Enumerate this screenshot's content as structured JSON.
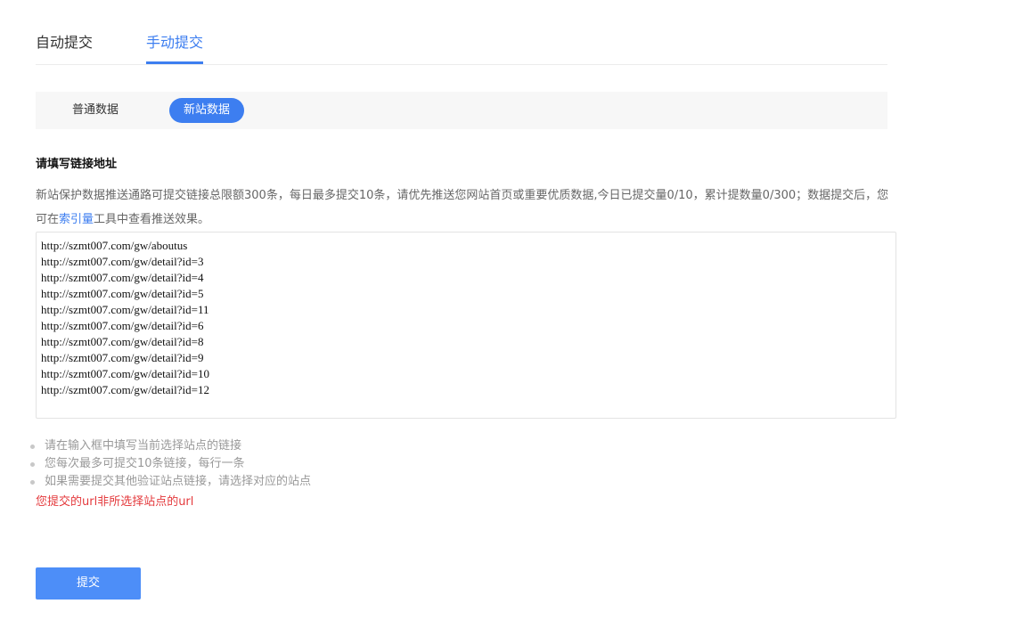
{
  "top_tabs": {
    "auto": "自动提交",
    "manual": "手动提交"
  },
  "sub_tabs": {
    "normal": "普通数据",
    "newsite": "新站数据"
  },
  "section": {
    "title": "请填写链接地址",
    "desc_part1": "新站保护数据推送通路可提交链接总限额300条，每日最多提交10条，请优先推送您网站首页或重要优质数据,今日已提交量0/10，累计提数量0/300；数据提交后，您可在",
    "desc_link": "索引量",
    "desc_part2": "工具中查看推送效果。"
  },
  "urls": [
    "http://szmt007.com/gw/aboutus",
    "http://szmt007.com/gw/detail?id=3",
    "http://szmt007.com/gw/detail?id=4",
    "http://szmt007.com/gw/detail?id=5",
    "http://szmt007.com/gw/detail?id=11",
    "http://szmt007.com/gw/detail?id=6",
    "http://szmt007.com/gw/detail?id=8",
    "http://szmt007.com/gw/detail?id=9",
    "http://szmt007.com/gw/detail?id=10",
    "http://szmt007.com/gw/detail?id=12"
  ],
  "tips": [
    "请在输入框中填写当前选择站点的链接",
    "您每次最多可提交10条链接，每行一条",
    "如果需要提交其他验证站点链接，请选择对应的站点"
  ],
  "error": "您提交的url非所选择站点的url",
  "submit_label": "提交",
  "colors": {
    "accent": "#3d7ef0",
    "button": "#4d8ef8",
    "error": "#e4393c"
  }
}
